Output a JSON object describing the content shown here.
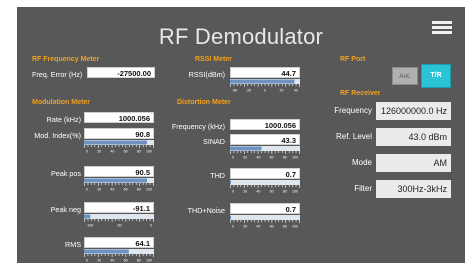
{
  "title": "RF Demodulator",
  "freq_meter": {
    "header": "RF Frequency Meter",
    "label": "Freq. Error (Hz)",
    "value": "-27500.00"
  },
  "rssi": {
    "header": "RSSI Meter",
    "label": "RSSI(dBm)",
    "value": "44.7",
    "level": 0.92,
    "ticks": [
      "-50",
      "-20",
      "0",
      "20",
      "40"
    ]
  },
  "modulation": {
    "header": "Modulation Meter",
    "rate": {
      "label": "Rate (kHz)",
      "value": "1000.056"
    },
    "index": {
      "label": "Mod. Index(%)",
      "value": "90.8",
      "level": 0.9,
      "ticks": [
        "0",
        "20",
        "40",
        "60",
        "80",
        "100"
      ]
    },
    "peak_pos": {
      "label": "Peak pos",
      "value": "90.5",
      "level": 0.9,
      "ticks": [
        "0",
        "20",
        "40",
        "60",
        "80",
        "100"
      ]
    },
    "peak_neg": {
      "label": "Peak neg",
      "value": "-91.1",
      "level": 0.09,
      "ticks": [
        "-100",
        "-50",
        "0"
      ]
    },
    "rms": {
      "label": "RMS",
      "value": "64.1",
      "level": 0.64,
      "ticks": [
        "0",
        "20",
        "40",
        "60",
        "80",
        "100"
      ]
    }
  },
  "distortion": {
    "header": "Distortion Meter",
    "frequency": {
      "label": "Frequency (kHz)",
      "value": "1000.056"
    },
    "sinad": {
      "label": "SINAD",
      "value": "43.3",
      "level": 0.45,
      "ticks": [
        "0",
        "20",
        "40",
        "60",
        "80",
        "100"
      ]
    },
    "thd": {
      "label": "THD",
      "value": "0.7",
      "level": 0.01,
      "ticks": [
        "0",
        "20",
        "40",
        "60",
        "80",
        "100"
      ]
    },
    "thd_noise": {
      "label": "THD+Noise",
      "value": "0.7",
      "level": 0.01,
      "ticks": [
        "0",
        "20",
        "40",
        "60",
        "80",
        "100"
      ]
    }
  },
  "rf_port": {
    "header": "RF Port",
    "ant_label": "Ant.",
    "tr_label": "T/R",
    "active": "T/R"
  },
  "rf_receiver": {
    "header": "RF Receiver",
    "frequency": {
      "label": "Frequency",
      "value": "126000000.0 Hz"
    },
    "ref_level": {
      "label": "Ref. Level",
      "value": "43.0 dBm"
    },
    "mode": {
      "label": "Mode",
      "value": "AM"
    },
    "filter": {
      "label": "Filter",
      "value": "300Hz-3kHz"
    }
  },
  "colors": {
    "accent": "#f2a11e",
    "panel": "#585858",
    "tr_active": "#2bc4d6",
    "ant_inactive": "#b0b0b0"
  },
  "icons": {
    "menu": "hamburger-menu-icon"
  }
}
